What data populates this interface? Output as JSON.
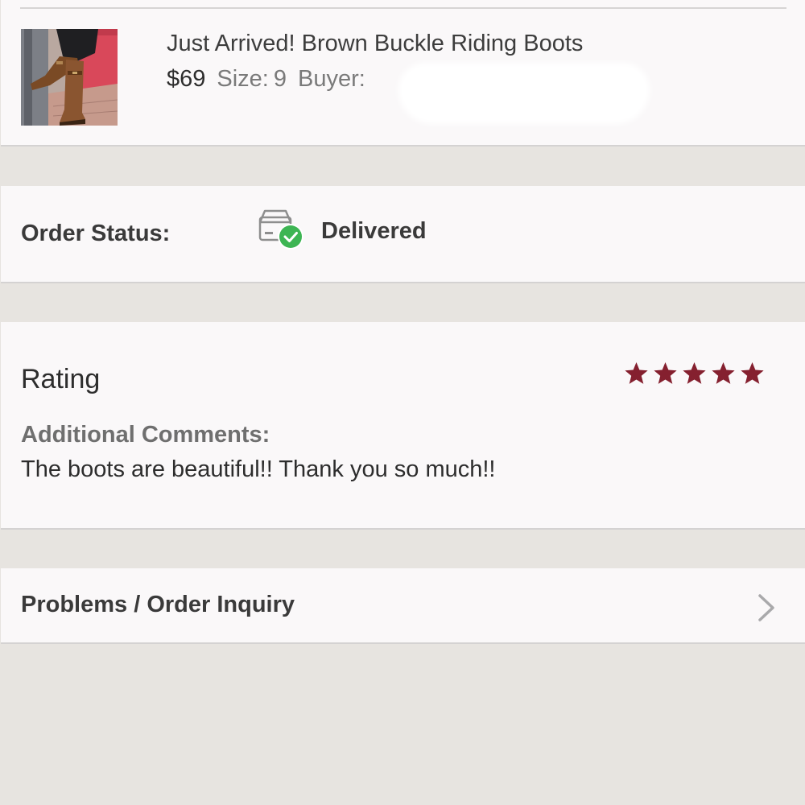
{
  "product": {
    "title": "Just Arrived! Brown Buckle Riding Boots",
    "price": "$69",
    "size_label": "Size:",
    "size_value": "9",
    "buyer_label": "Buyer:",
    "thumbnail_icon": "boots-photo"
  },
  "order_status": {
    "label": "Order Status:",
    "value": "Delivered",
    "icon": "delivered-box-check-icon",
    "status_color": "#3db553"
  },
  "rating": {
    "label": "Rating",
    "stars": 5,
    "max_stars": 5,
    "star_color": "#85202f",
    "comments_label": "Additional Comments:",
    "comments_text": "The boots are beautiful!! Thank you so much!!"
  },
  "inquiry": {
    "label": "Problems / Order Inquiry",
    "icon": "chevron-right-icon"
  }
}
